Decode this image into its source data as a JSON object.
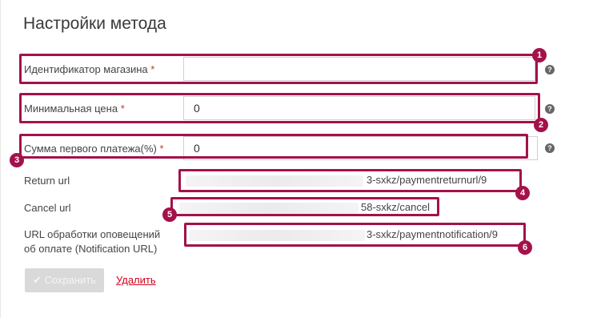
{
  "page": {
    "title": "Настройки метода"
  },
  "fields": {
    "shop_id": {
      "label": "Идентификатор магазина",
      "value": "",
      "required_mark": "*",
      "help": "?"
    },
    "min_price": {
      "label": "Минимальная цена",
      "value": "0",
      "required_mark": "*",
      "help": "?"
    },
    "first_payment": {
      "label": "Сумма первого платежа(%)",
      "value": "0",
      "required_mark": "*",
      "help": "?"
    }
  },
  "urls": {
    "return": {
      "label": "Return url",
      "value": "3-sxkz/paymentreturnurl/9"
    },
    "cancel": {
      "label": "Cancel url",
      "value": "58-sxkz/cancel"
    },
    "notification": {
      "label_line1": "URL обработки оповещений",
      "label_line2": "об оплате (Notification URL)",
      "value": "3-sxkz/paymentnotification/9"
    }
  },
  "actions": {
    "save_label": "✔ Сохранить",
    "delete_label": "Удалить"
  },
  "badges": [
    "1",
    "2",
    "3",
    "4",
    "5",
    "6"
  ],
  "colors": {
    "highlight": "#a3124a",
    "required": "#c0392b",
    "delete_link": "#d0021b"
  }
}
